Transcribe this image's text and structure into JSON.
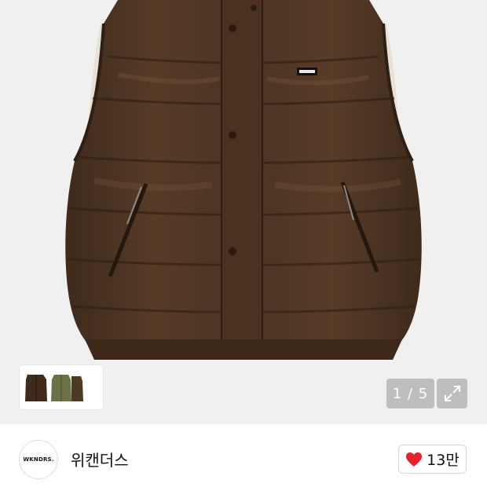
{
  "gallery": {
    "current_page": "1",
    "total_pages": "5",
    "page_indicator": "1 / 5",
    "expand_icon": "expand-arrows-icon",
    "next_icon": "chevron-right-icon"
  },
  "seller": {
    "avatar_logo_text": "WKNDRS.",
    "name": "위캔더스"
  },
  "like": {
    "icon": "heart-icon",
    "count": "13만",
    "color": "#e8202a"
  },
  "colors": {
    "vest_brown": "#4e3524",
    "vest_olive": "#6b7346",
    "background": "#f0f0f0"
  }
}
